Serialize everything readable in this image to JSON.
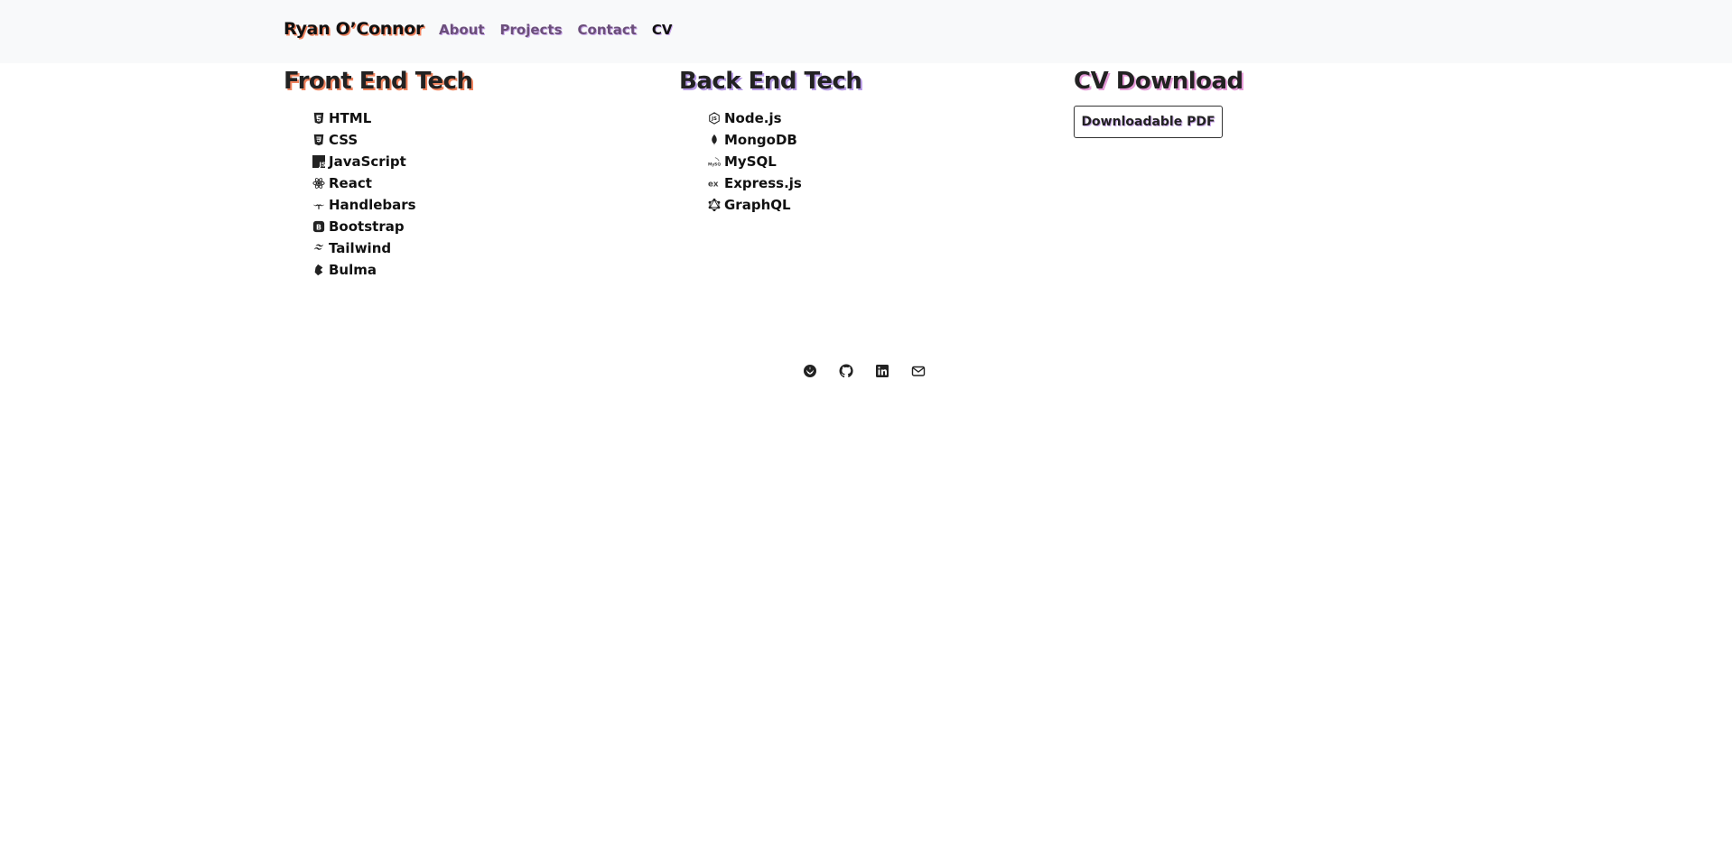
{
  "nav": {
    "brand": "Ryan O’Connor",
    "links": [
      {
        "label": "About"
      },
      {
        "label": "Projects"
      },
      {
        "label": "Contact"
      },
      {
        "label": "CV"
      }
    ]
  },
  "front": {
    "title": "Front End Tech",
    "items": [
      {
        "label": "HTML",
        "icon": "html5-icon"
      },
      {
        "label": "CSS",
        "icon": "css3-icon"
      },
      {
        "label": "JavaScript",
        "icon": "javascript-icon"
      },
      {
        "label": "React",
        "icon": "react-icon"
      },
      {
        "label": "Handlebars",
        "icon": "handlebars-icon"
      },
      {
        "label": "Bootstrap",
        "icon": "bootstrap-icon"
      },
      {
        "label": "Tailwind",
        "icon": "tailwind-icon"
      },
      {
        "label": "Bulma",
        "icon": "bulma-icon"
      }
    ]
  },
  "back": {
    "title": "Back End Tech",
    "items": [
      {
        "label": "Node.js",
        "icon": "nodejs-icon"
      },
      {
        "label": "MongoDB",
        "icon": "mongodb-icon"
      },
      {
        "label": "MySQL",
        "icon": "mysql-icon"
      },
      {
        "label": "Express.js",
        "icon": "express-icon"
      },
      {
        "label": "GraphQL",
        "icon": "graphql-icon"
      }
    ]
  },
  "cv": {
    "title": "CV Download",
    "button_label": "Downloadable PDF"
  },
  "footer": {
    "social": [
      {
        "icon": "rebel-icon"
      },
      {
        "icon": "github-icon"
      },
      {
        "icon": "linkedin-icon"
      },
      {
        "icon": "email-icon"
      }
    ]
  },
  "colors": {
    "navbar_bg": "#f8f9fa",
    "brand_shadow": "#f0835e",
    "nav_link": "#6b4f7a",
    "purple_shadow": "#c9a6ea"
  }
}
